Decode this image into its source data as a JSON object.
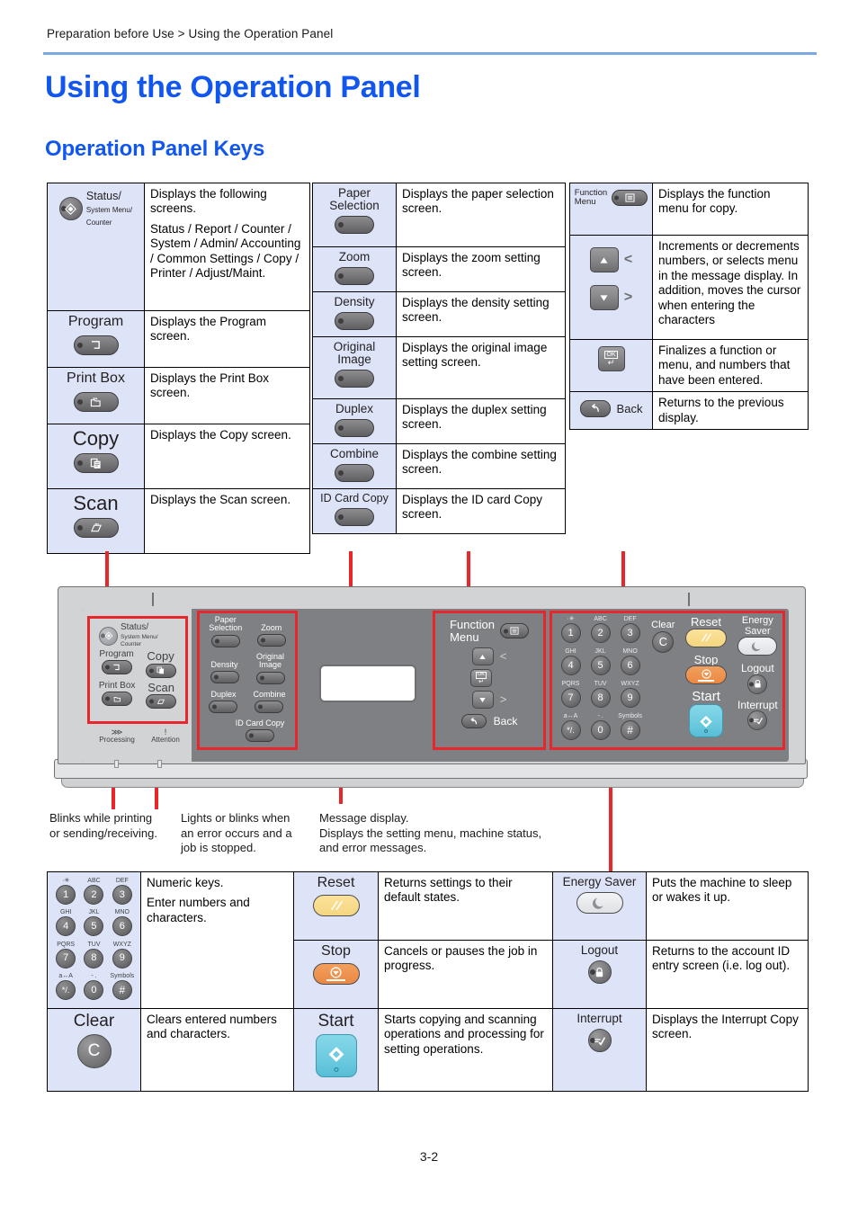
{
  "header": {
    "breadcrumb": "Preparation before Use > Using the Operation Panel",
    "title": "Using the Operation Panel",
    "subtitle": "Operation Panel Keys"
  },
  "footer": {
    "page_number": "3-2"
  },
  "colors": {
    "heading": "#1157ef",
    "rule": "#7da7e0",
    "key_cell_bg": "#dde4f7",
    "callout": "#e8262b",
    "panel_body": "#d2d3d5",
    "panel_inner": "#7e8083",
    "reset_key": "#f5d680",
    "stop_key": "#ea8842",
    "start_key": "#6ecbe0",
    "energy_saver_key": "#e0e1e4"
  },
  "table_left": {
    "rows": [
      {
        "key_label_main": "Status/",
        "key_label_sub1": "System Menu/",
        "key_label_sub2": "Counter",
        "icon": "status-diamond-icon",
        "desc": [
          "Displays the following screens.",
          "Status / Report / Counter / System / Admin/ Accounting / Common Settings / Copy / Printer / Adjust/Maint."
        ]
      },
      {
        "key_label_main": "Program",
        "icon": "program-icon",
        "desc": [
          "Displays the Program screen."
        ]
      },
      {
        "key_label_main": "Print Box",
        "icon": "print-box-icon",
        "desc": [
          "Displays the Print Box screen."
        ]
      },
      {
        "key_label_main": "Copy",
        "icon": "copy-icon",
        "desc": [
          "Displays the Copy screen."
        ]
      },
      {
        "key_label_main": "Scan",
        "icon": "scan-icon",
        "desc": [
          "Displays the Scan screen."
        ]
      }
    ]
  },
  "table_middle": {
    "rows": [
      {
        "key_label_main": "Paper",
        "key_label_sub1": "Selection",
        "desc": [
          "Displays the paper selection screen."
        ]
      },
      {
        "key_label_main": "Zoom",
        "desc": [
          "Displays the zoom setting screen."
        ]
      },
      {
        "key_label_main": "Density",
        "desc": [
          "Displays the density setting screen."
        ]
      },
      {
        "key_label_main": "Original",
        "key_label_sub1": "Image",
        "desc": [
          "Displays the original image setting screen."
        ]
      },
      {
        "key_label_main": "Duplex",
        "desc": [
          "Displays the duplex setting screen."
        ]
      },
      {
        "key_label_main": "Combine",
        "desc": [
          "Displays the combine setting screen."
        ]
      },
      {
        "key_label_main": "ID Card Copy",
        "desc": [
          "Displays the ID card Copy screen."
        ]
      }
    ]
  },
  "table_right": {
    "rows": [
      {
        "key_label_main": "Function",
        "key_label_sub1": "Menu",
        "icon": "function-menu-icon",
        "desc": [
          "Displays the function menu for copy."
        ]
      },
      {
        "key_label_main": "",
        "icon": "arrow-up-down-icon",
        "left_glyph": "<",
        "right_glyph": ">",
        "desc": [
          "Increments or decrements numbers, or selects menu in the message display. In addition, moves the cursor when entering the characters"
        ]
      },
      {
        "key_label_main": "",
        "icon": "ok-enter-icon",
        "ok_text": "OK",
        "desc": [
          "Finalizes a function or menu, and numbers that have been entered."
        ]
      },
      {
        "key_label_main": "Back",
        "icon": "back-arrow-icon",
        "desc": [
          "Returns to the previous display."
        ]
      }
    ]
  },
  "diagram": {
    "left_group": {
      "status_main": "Status/",
      "status_sub1": "System Menu/",
      "status_sub2": "Counter",
      "program": "Program",
      "copy": "Copy",
      "print_box": "Print Box",
      "scan": "Scan"
    },
    "indicators": {
      "processing": "Processing",
      "processing_glyph": "⋙",
      "attention": "Attention",
      "attention_glyph": "!"
    },
    "copy_group": {
      "paper_selection_l1": "Paper",
      "paper_selection_l2": "Selection",
      "zoom": "Zoom",
      "density": "Density",
      "original_image_l1": "Original",
      "original_image_l2": "Image",
      "duplex": "Duplex",
      "combine": "Combine",
      "id_card_copy": "ID Card Copy"
    },
    "function_group": {
      "function_l1": "Function",
      "function_l2": "Menu",
      "left_glyph": "<",
      "right_glyph": ">",
      "ok_text": "OK",
      "back": "Back"
    },
    "keypad": {
      "keys": [
        {
          "sub": "·✳",
          "num": "1"
        },
        {
          "sub": "ABC",
          "num": "2"
        },
        {
          "sub": "DEF",
          "num": "3"
        },
        {
          "sub": "GHI",
          "num": "4"
        },
        {
          "sub": "JKL",
          "num": "5"
        },
        {
          "sub": "MNO",
          "num": "6"
        },
        {
          "sub": "PQRS",
          "num": "7"
        },
        {
          "sub": "TUV",
          "num": "8"
        },
        {
          "sub": "WXYZ",
          "num": "9"
        },
        {
          "sub": "a↔A",
          "num": "*/."
        },
        {
          "sub": "- .",
          "num": "0"
        },
        {
          "sub": "Symbols",
          "num": "#"
        }
      ],
      "clear": "Clear",
      "clear_glyph": "C",
      "reset": "Reset",
      "energy_saver": "Energy Saver",
      "stop": "Stop",
      "logout": "Logout",
      "start": "Start",
      "interrupt": "Interrupt"
    },
    "captions": [
      "Blinks while printing or sending/receiving.",
      "Lights or blinks when an error occurs and a job is stopped.",
      "Message display.\nDisplays the setting menu, machine status, and error messages."
    ],
    "caption_1_line1": "Blinks while printing",
    "caption_1_line2": "or sending/receiving.",
    "caption_2_line1": "Lights or blinks when",
    "caption_2_line2": "an error occurs and a",
    "caption_2_line3": "job is stopped.",
    "caption_3_line1": "Message display.",
    "caption_3_line2": "Displays the setting menu, machine status,",
    "caption_3_line3": "and error messages."
  },
  "table_bottom": {
    "cells": [
      {
        "key_label": "",
        "icon": "numeric-keypad-icon",
        "desc": [
          "Numeric keys.",
          "Enter numbers and characters."
        ]
      },
      {
        "key_label": "Reset",
        "icon": "reset-key-icon",
        "desc": [
          "Returns settings to their default states."
        ]
      },
      {
        "key_label": "Energy Saver",
        "icon": "energy-saver-moon-icon",
        "desc": [
          "Puts the machine to sleep or wakes it up."
        ]
      },
      {
        "key_label": "Stop",
        "icon": "stop-key-icon",
        "desc": [
          "Cancels or pauses the job in progress."
        ]
      },
      {
        "key_label": "Logout",
        "icon": "logout-lock-icon",
        "desc": [
          "Returns to the account ID entry screen (i.e. log out)."
        ]
      },
      {
        "key_label": "Clear",
        "key_glyph": "C",
        "icon": "clear-key-icon",
        "desc": [
          "Clears entered numbers and characters."
        ]
      },
      {
        "key_label": "Start",
        "icon": "start-key-icon",
        "desc": [
          "Starts copying and scanning operations and processing for setting operations."
        ]
      },
      {
        "key_label": "Interrupt",
        "icon": "interrupt-icon",
        "desc": [
          "Displays the Interrupt Copy screen."
        ]
      }
    ]
  }
}
